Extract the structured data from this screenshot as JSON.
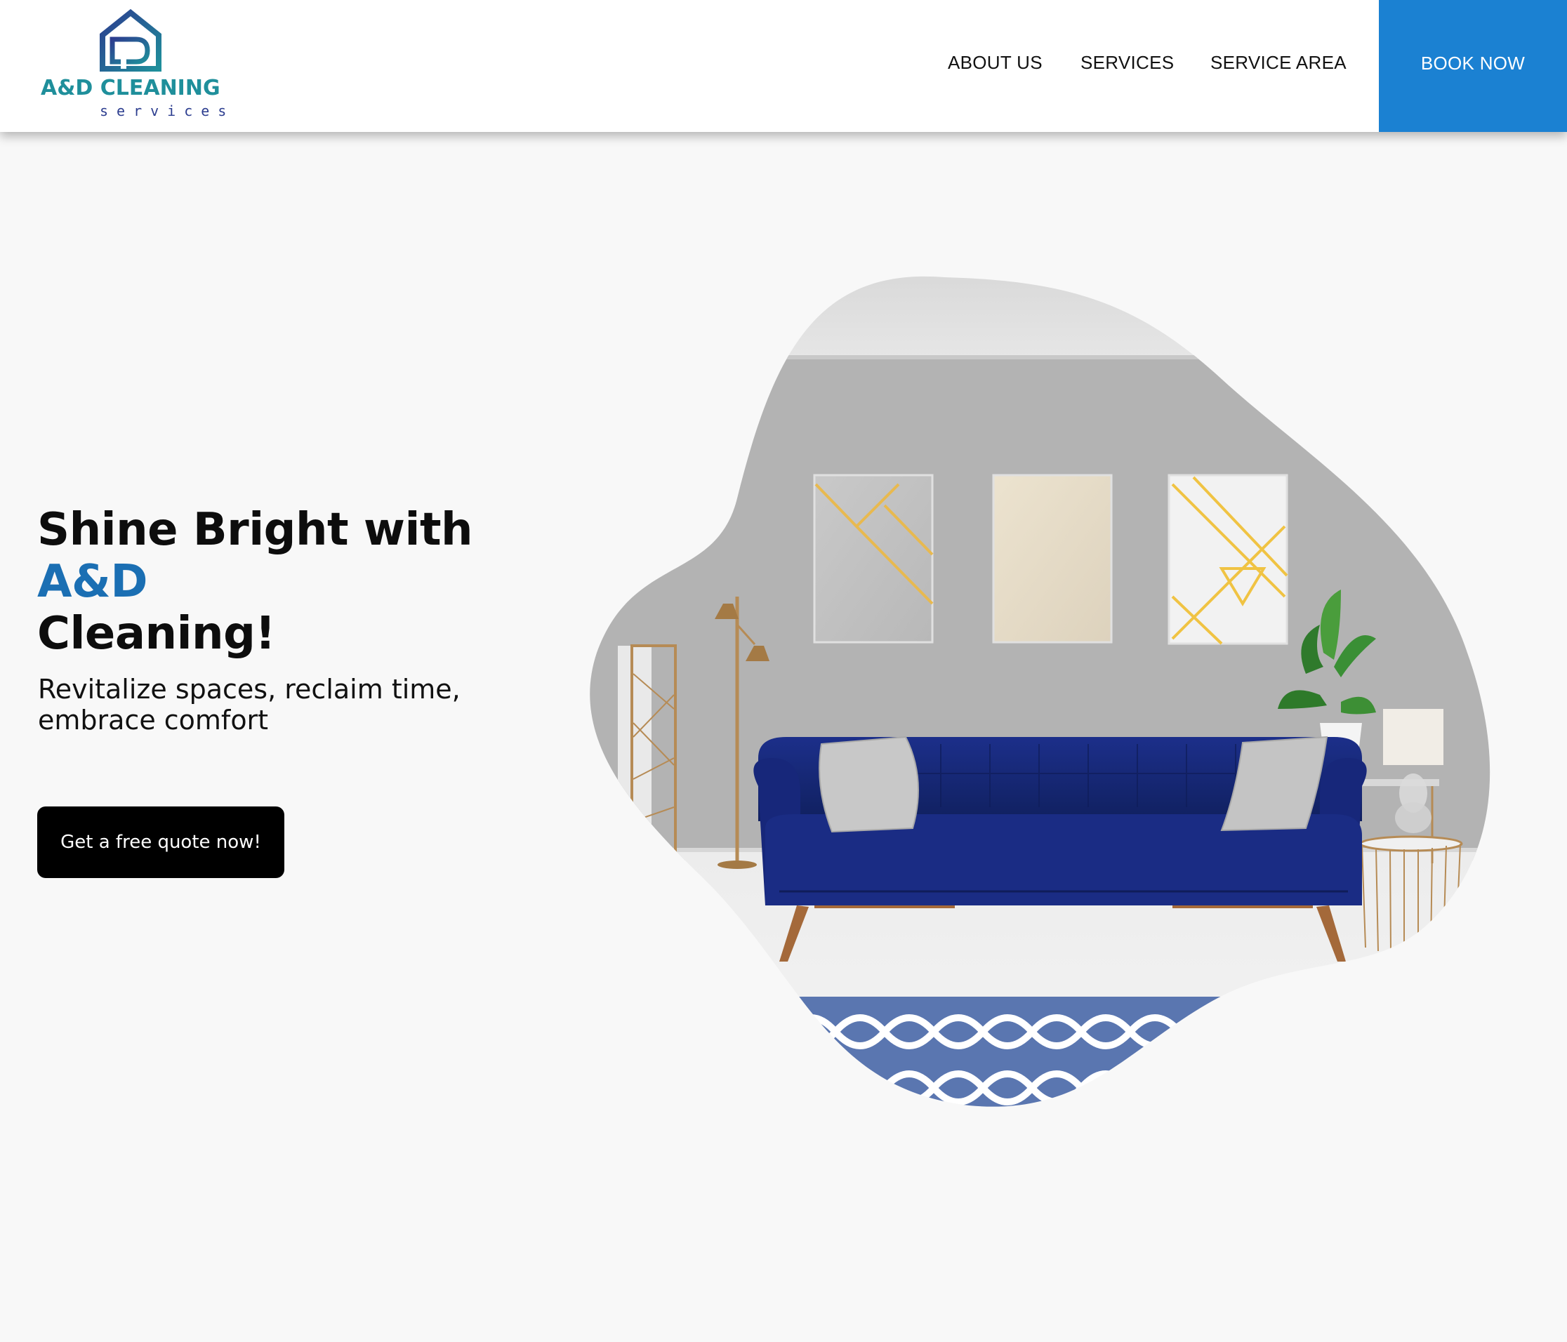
{
  "header": {
    "logo": {
      "name": "A&D CLEANING",
      "tagline": "services"
    },
    "nav": [
      {
        "label": "ABOUT US"
      },
      {
        "label": "SERVICES"
      },
      {
        "label": "SERVICE AREA"
      }
    ],
    "book_now_label": "BOOK NOW"
  },
  "hero": {
    "title_part1": "Shine Bright with ",
    "title_accent": "A&D",
    "title_part2": "Cleaning!",
    "subtitle": "Revitalize spaces, reclaim time, embrace comfort",
    "cta_label": "Get a free quote now!"
  },
  "colors": {
    "accent": "#1b81d2",
    "title_accent": "#1b6fb3",
    "logo_teal": "#1f8f9b",
    "logo_navy": "#2c3d8f",
    "sofa_blue": "#16277a",
    "background": "#f8f8f8"
  },
  "icons": {
    "logo_mark": "house-d-icon"
  }
}
